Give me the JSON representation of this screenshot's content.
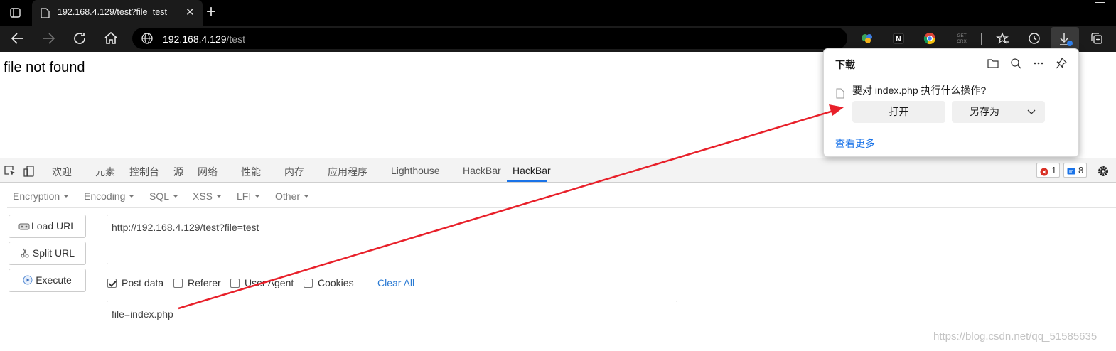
{
  "browser": {
    "tab_title": "192.168.4.129/test?file=test",
    "new_tab_symbol": "+",
    "close_symbol": "✕",
    "address": {
      "host": "192.168.4.129",
      "path": "/test"
    },
    "extensions": [
      "colorful-ext-icon",
      "notion-icon",
      "chrome-icon",
      "get-crx-icon"
    ],
    "get_crx_label": "GET\nCRX"
  },
  "page": {
    "message": "file not found"
  },
  "devtools": {
    "tabs": [
      "欢迎",
      "元素",
      "控制台",
      "源",
      "网络",
      "性能",
      "内存",
      "应用程序",
      "Lighthouse",
      "HackBar",
      "HackBar"
    ],
    "active_tab": 10,
    "errors_count": "1",
    "messages_count": "8"
  },
  "hackbar": {
    "menu": [
      "Encryption",
      "Encoding",
      "SQL",
      "XSS",
      "LFI",
      "Other"
    ],
    "buttons": {
      "load_url": "Load URL",
      "split_url": "Split URL",
      "execute": "Execute"
    },
    "url_value": "http://192.168.4.129/test?file=test",
    "options": [
      {
        "label": "Post data",
        "checked": true
      },
      {
        "label": "Referer",
        "checked": false
      },
      {
        "label": "User Agent",
        "checked": false
      },
      {
        "label": "Cookies",
        "checked": false
      }
    ],
    "clear_all": "Clear All",
    "post_value": "file=index.php"
  },
  "download_popup": {
    "title": "下载",
    "question": "要对 index.php 执行什么操作?",
    "open_button": "打开",
    "save_as_button": "另存为",
    "see_more": "查看更多"
  },
  "watermark": "https://blog.csdn.net/qq_51585635",
  "colors": {
    "accent": "#1a73e8",
    "annotation_arrow": "#e8202a",
    "chrome_bg": "#1b1b1b"
  }
}
